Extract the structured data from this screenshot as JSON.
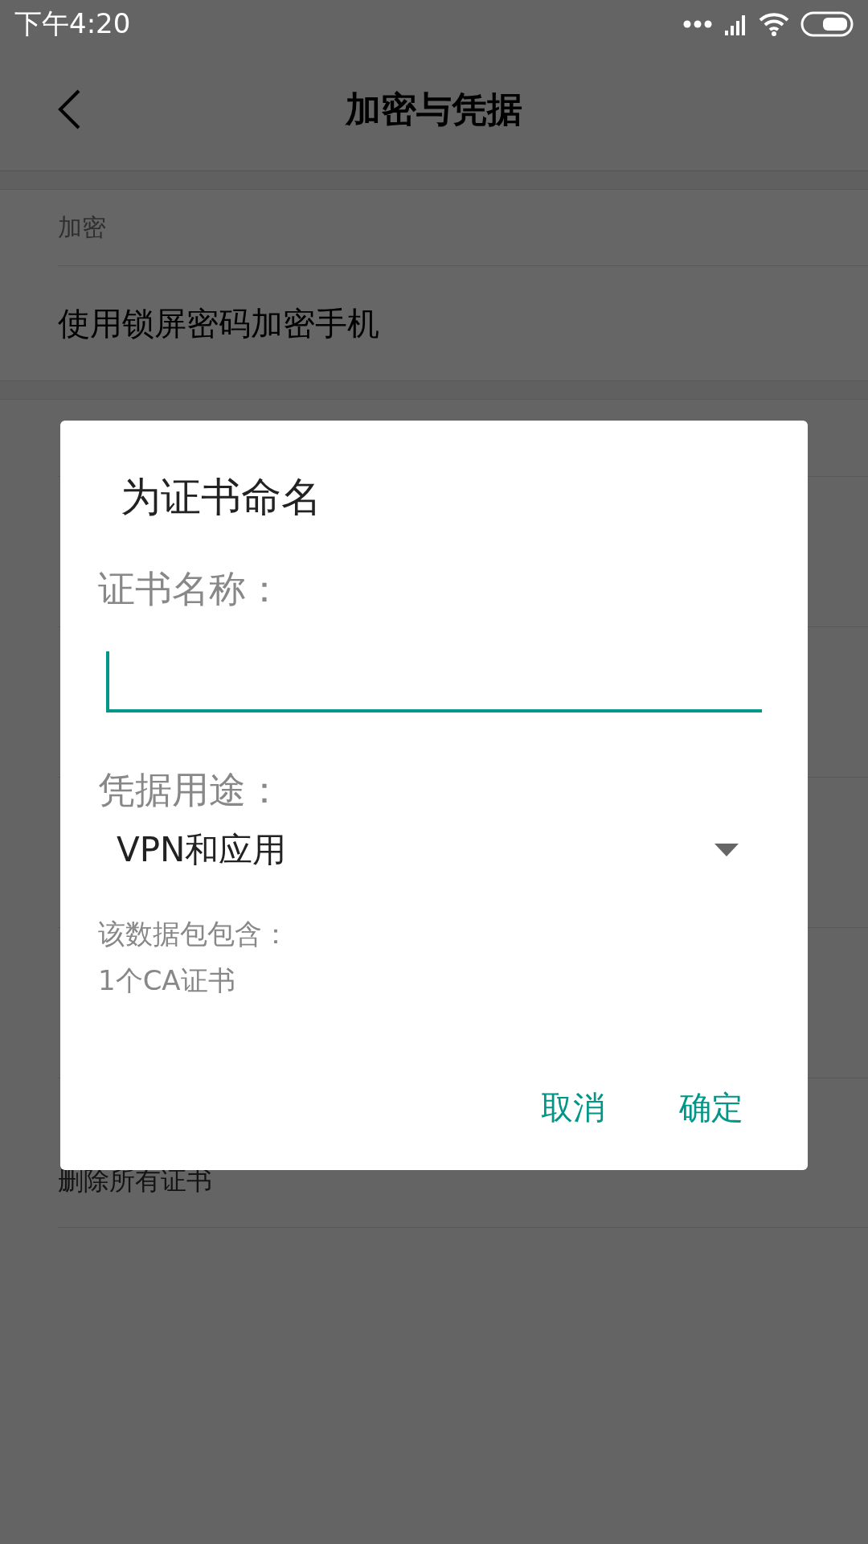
{
  "status_bar": {
    "time": "下午4:20"
  },
  "app_bar": {
    "title": "加密与凭据"
  },
  "sections": [
    {
      "header": "加密",
      "items": [
        "使用锁屏密码加密手机"
      ]
    }
  ],
  "covered_item": "删除所有证书",
  "dialog": {
    "title": "为证书命名",
    "name_label": "证书名称：",
    "purpose_label": "凭据用途：",
    "purpose_value": "VPN和应用",
    "contents_label": "该数据包包含：",
    "contents_value": "1个CA证书",
    "buttons": [
      "取消",
      "确定"
    ]
  }
}
